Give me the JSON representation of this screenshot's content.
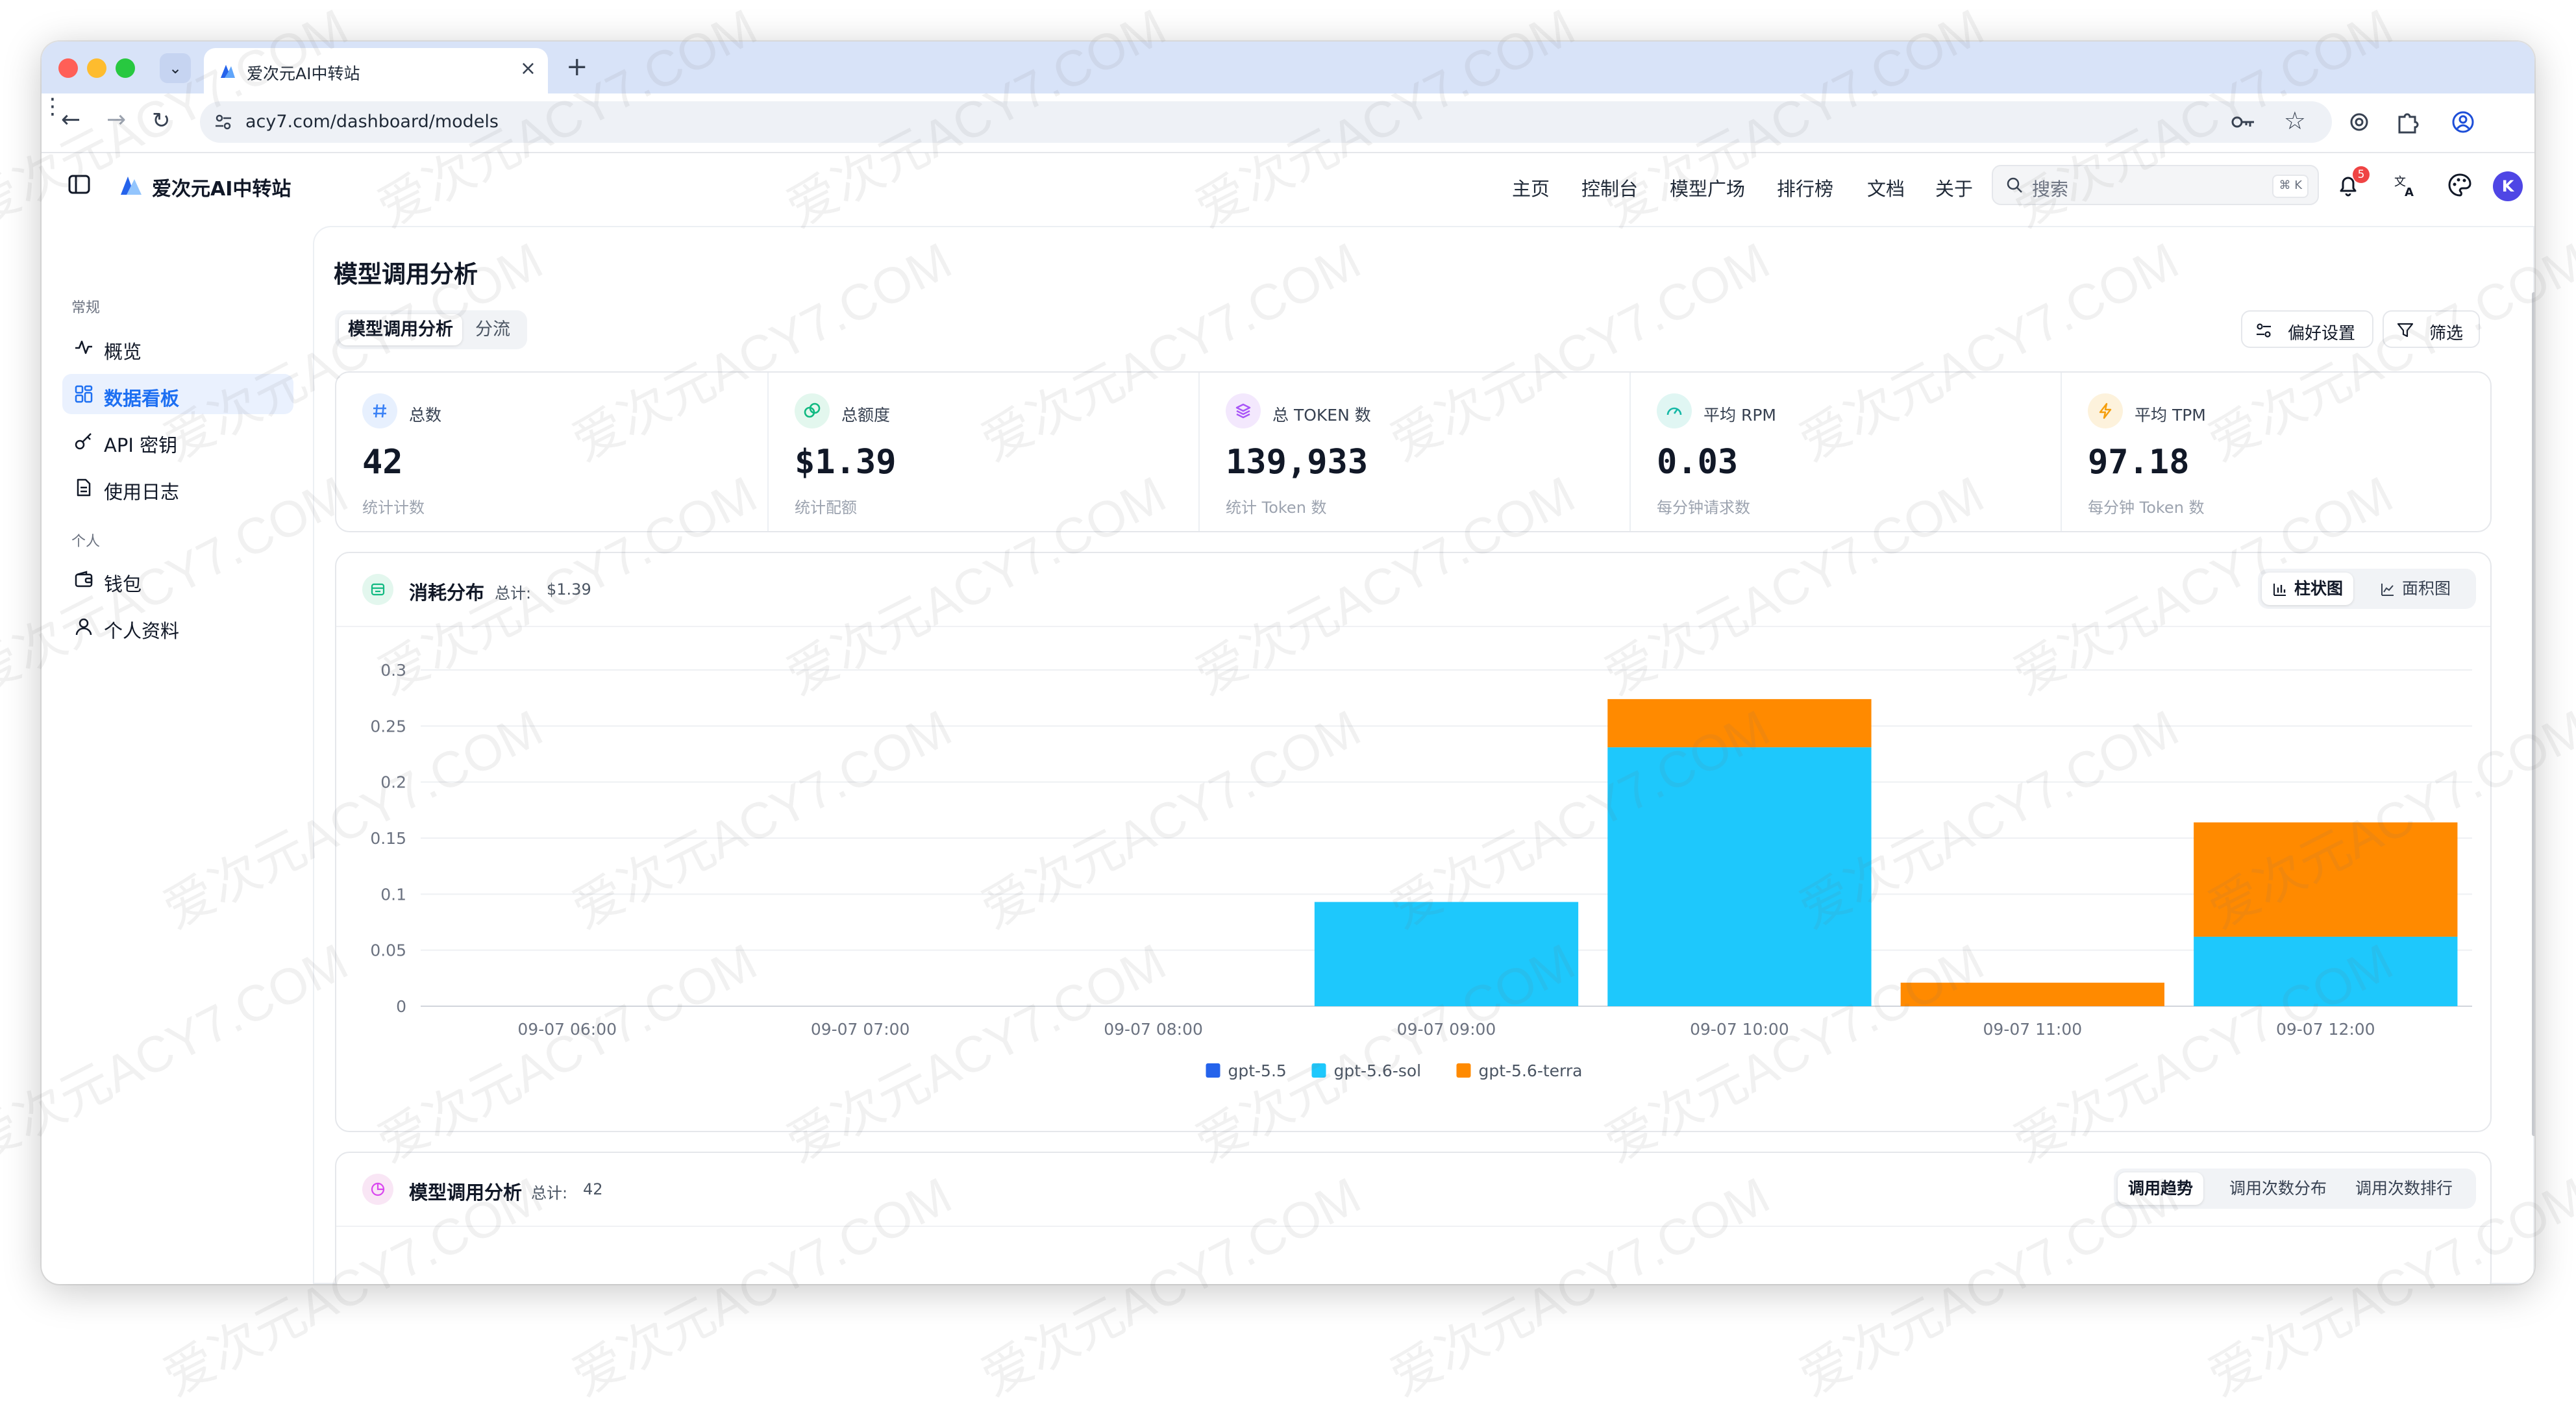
{
  "browser": {
    "tab_title": "爱次元AI中转站",
    "url": "acy7.com/dashboard/models"
  },
  "header": {
    "brand": "爱次元AI中转站",
    "nav": [
      "主页",
      "控制台",
      "模型广场",
      "排行榜",
      "文档",
      "关于"
    ],
    "search_placeholder": "搜索",
    "search_shortcut": "⌘ K",
    "notification_count": "5",
    "avatar_letter": "K"
  },
  "sidebar": {
    "sections": [
      {
        "title": "常规",
        "items": [
          {
            "label": "概览",
            "icon": "activity-icon"
          },
          {
            "label": "数据看板",
            "icon": "grid-icon",
            "active": true
          },
          {
            "label": "API 密钥",
            "icon": "key-icon"
          },
          {
            "label": "使用日志",
            "icon": "document-icon"
          }
        ]
      },
      {
        "title": "个人",
        "items": [
          {
            "label": "钱包",
            "icon": "wallet-icon"
          },
          {
            "label": "个人资料",
            "icon": "user-icon"
          }
        ]
      }
    ]
  },
  "page": {
    "title": "模型调用分析",
    "tabs": [
      "模型调用分析",
      "分流"
    ],
    "preferences_label": "偏好设置",
    "filter_label": "筛选"
  },
  "stats": [
    {
      "label": "总数",
      "value": "42",
      "sub": "统计计数",
      "icon": "hash-icon",
      "color": "#3b82f6"
    },
    {
      "label": "总额度",
      "value": "$1.39",
      "sub": "统计配额",
      "icon": "coins-icon",
      "color": "#10b981"
    },
    {
      "label": "总 TOKEN 数",
      "value": "139,933",
      "sub": "统计 Token 数",
      "icon": "layers-icon",
      "color": "#a855f7"
    },
    {
      "label": "平均 RPM",
      "value": "0.03",
      "sub": "每分钟请求数",
      "icon": "gauge-icon",
      "color": "#14b8a6"
    },
    {
      "label": "平均 TPM",
      "value": "97.18",
      "sub": "每分钟 Token 数",
      "icon": "bolt-icon",
      "color": "#f59e0b"
    }
  ],
  "consumption_card": {
    "title": "消耗分布",
    "total_label": "总计:",
    "total_value": "$1.39",
    "views": [
      "柱状图",
      "面积图"
    ]
  },
  "analysis_card": {
    "title": "模型调用分析",
    "total_label": "总计:",
    "total_value": "42",
    "views": [
      "调用趋势",
      "调用次数分布",
      "调用次数排行"
    ]
  },
  "chart_data": {
    "type": "bar",
    "stacked": true,
    "categories": [
      "09-07 06:00",
      "09-07 07:00",
      "09-07 08:00",
      "09-07 09:00",
      "09-07 10:00",
      "09-07 11:00",
      "09-07 12:00"
    ],
    "series": [
      {
        "name": "gpt-5.5",
        "color": "#2563eb",
        "values": [
          0,
          0,
          0,
          0,
          0,
          0,
          0
        ]
      },
      {
        "name": "gpt-5.6-sol",
        "color": "#1ec8fc",
        "values": [
          0,
          0,
          0,
          0.093,
          0.231,
          0,
          0.062
        ]
      },
      {
        "name": "gpt-5.6-terra",
        "color": "#ff8a00",
        "values": [
          0,
          0,
          0,
          0,
          0.043,
          0.021,
          0.102
        ]
      }
    ],
    "series_order_bottom_to_top": [
      "gpt-5.5",
      "gpt-5.6-sol",
      "gpt-5.6-terra"
    ],
    "yticks": [
      0,
      0.05,
      0.1,
      0.15,
      0.2,
      0.25,
      0.3
    ],
    "ytick_labels": [
      "0",
      "0.05",
      "0.1",
      "0.15",
      "0.2",
      "0.25",
      "0.3"
    ],
    "ylim": [
      0,
      0.3
    ],
    "grid": true,
    "legend": "bottom-center"
  },
  "watermark": "爱次元ACY7.COM"
}
